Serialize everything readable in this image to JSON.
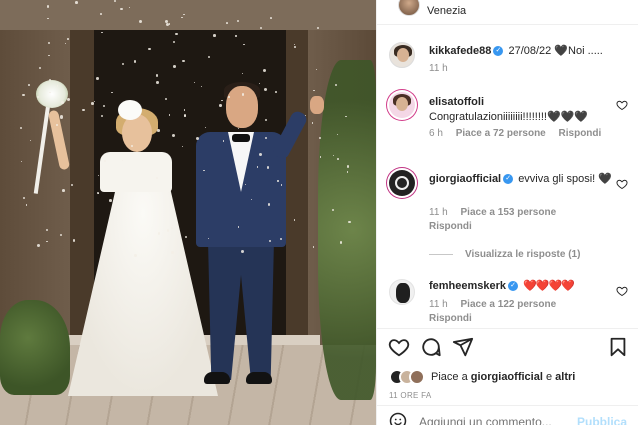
{
  "post": {
    "location": "Venezia",
    "photo_alt": "wedding photo"
  },
  "comments": [
    {
      "user": "kikkafede88",
      "text": "27/08/22 🖤Noi .....",
      "time": "11 h",
      "verified": true
    },
    {
      "user": "elisatoffoli",
      "text": "Congratulazioniiiiiiii!!!!!!!!🖤🖤🖤",
      "time": "6 h",
      "likes": "Piace a 72 persone",
      "reply": "Rispondi",
      "verified": false
    },
    {
      "user": "giorgiaofficial",
      "text": "evviva gli sposi! 🖤",
      "time": "11 h",
      "likes": "Piace a 153 persone",
      "reply": "Rispondi",
      "verified": true,
      "view_replies": "Visualizza le risposte (1)"
    },
    {
      "user": "femheemskerk",
      "text": "❤️❤️❤️❤️",
      "time": "11 h",
      "likes": "Piace a 122 persone",
      "reply": "Rispondi",
      "verified": true
    }
  ],
  "liked_by": {
    "prefix": "Piace a",
    "user": "giorgiaofficial",
    "connector": "e",
    "others": "altri"
  },
  "time_ago": "11 ORE FA",
  "add_comment": {
    "placeholder": "Aggiungi un commento...",
    "publish": "Pubblica"
  },
  "icons": {
    "like": "heart-icon",
    "comment": "comment-icon",
    "share": "paper-plane-icon",
    "save": "bookmark-icon",
    "emoji": "smiley-icon"
  },
  "colors": {
    "verified": "#3897f0",
    "secondary_text": "#8e8e8e",
    "publish_disabled": "#b2dffc",
    "heart_red": "#ed4956"
  }
}
